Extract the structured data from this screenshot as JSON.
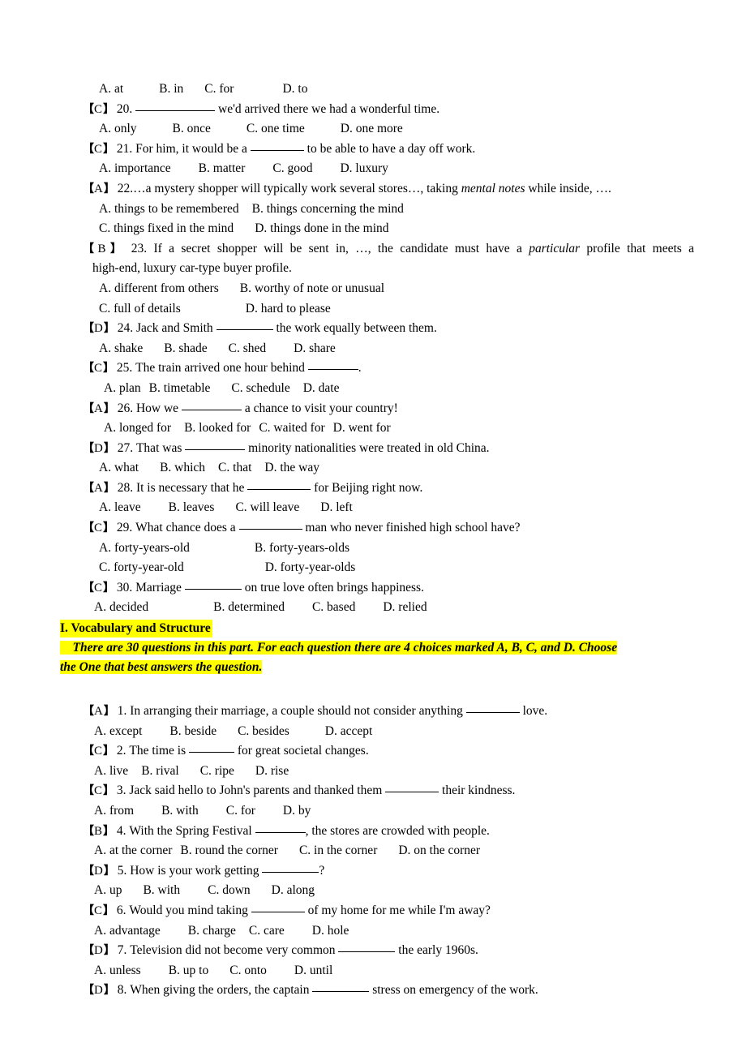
{
  "document": {
    "title": "Vocabulary and Structure Exam Paper",
    "highlight_color": "#ffff00",
    "text_color": "#000000",
    "background_color": "#ffffff"
  },
  "top_block": {
    "orphan_options": {
      "a": "A. at",
      "b": "B. in",
      "c": "C. for",
      "d": "D. to"
    },
    "questions": [
      {
        "answer": "C",
        "number": "20.",
        "text_after_blank": "we'd arrived there we had a wonderful time.",
        "options": {
          "a": "A. only",
          "b": "B. once",
          "c": "C. one time",
          "d": "D. one more"
        }
      },
      {
        "answer": "C",
        "number": "21.",
        "text_before_blank": "For him, it would be a",
        "text_after_blank": "to be able to have a day off work.",
        "options": {
          "a": "A. importance",
          "b": "B. matter",
          "c": "C. good",
          "d": "D. luxury"
        }
      },
      {
        "answer": "A",
        "number": "22.",
        "text_part1": "…a mystery shopper will typically work several stores…, taking ",
        "italic": "mental notes",
        "text_part2": " while inside, ….",
        "options": {
          "a": "A. things to be remembered",
          "b": "B. things concerning the mind",
          "c": "C. things fixed in the mind",
          "d": "D. things done in the mind"
        }
      },
      {
        "answer": "B",
        "number": "23.",
        "text_part1": "If a secret shopper will be sent in, …, the candidate must have a ",
        "italic": "particular",
        "text_part2": " profile that meets a",
        "text_continuation": "high-end, luxury car-type buyer profile.",
        "options": {
          "a": "A. different from others",
          "b": "B. worthy of note or unusual",
          "c": "C. full of details",
          "d": "D. hard to please"
        }
      },
      {
        "answer": "D",
        "number": "24.",
        "text_before_blank": "Jack and Smith",
        "text_after_blank": "the work equally between them.",
        "options": {
          "a": "A. shake",
          "b": "B. shade",
          "c": "C. shed",
          "d": "D. share"
        }
      },
      {
        "answer": "C",
        "number": "25.",
        "text_before_blank": "The train arrived one hour behind",
        "text_after_blank": ".",
        "options": {
          "a": "A. plan",
          "b": "B. timetable",
          "c": "C. schedule",
          "d": "D. date"
        }
      },
      {
        "answer": "A",
        "number": "26.",
        "text_before_blank": "How we",
        "text_after_blank": "a chance to visit your country!",
        "options": {
          "a": "A. longed for",
          "b": "B. looked for",
          "c": "C. waited for",
          "d": "D. went for"
        }
      },
      {
        "answer": "D",
        "number": "27.",
        "text_before_blank": "That was",
        "text_after_blank": "minority nationalities were treated in old China.",
        "options": {
          "a": "A. what",
          "b": "B. which",
          "c": "C. that",
          "d": "D. the way"
        }
      },
      {
        "answer": "A",
        "number": "28.",
        "text_before_blank": "It is necessary that he",
        "text_after_blank": "for Beijing right now.",
        "options": {
          "a": "A. leave",
          "b": "B. leaves",
          "c": "C. will leave",
          "d": "D. left"
        }
      },
      {
        "answer": "C",
        "number": "29.",
        "text_before_blank": "What chance does a",
        "text_after_blank": "man who never finished high school have?",
        "options": {
          "a": "A. forty-years-old",
          "b": "B. forty-years-olds",
          "c": "C. forty-year-old",
          "d": "D. forty-year-olds"
        }
      },
      {
        "answer": "C",
        "number": "30.",
        "text_before_blank": "Marriage",
        "text_after_blank": "on true love often brings happiness.",
        "options": {
          "a": "A. decided",
          "b": "B. determined",
          "c": "C. based",
          "d": "D. relied"
        }
      }
    ]
  },
  "section": {
    "heading": "I. Vocabulary and Structure",
    "instruction_line1": "There are 30 questions in this part. For each question there are 4 choices marked A, B, C, and D. Choose",
    "instruction_line2": "the One that best answers the question."
  },
  "bottom_block": {
    "questions": [
      {
        "answer": "A",
        "number": "1.",
        "text_before_blank": "In arranging their marriage, a couple should not consider anything",
        "text_after_blank": "love.",
        "options": {
          "a": "A. except",
          "b": "B. beside",
          "c": "C. besides",
          "d": "D. accept"
        }
      },
      {
        "answer": "C",
        "number": "2.",
        "text_before_blank": "The time is",
        "text_after_blank": "for great societal changes.",
        "options": {
          "a": "A. live",
          "b": "B. rival",
          "c": "C. ripe",
          "d": "D. rise"
        }
      },
      {
        "answer": "C",
        "number": "3.",
        "text_before_blank": "Jack said hello to John's parents and thanked them",
        "text_after_blank": "their kindness.",
        "options": {
          "a": "A. from",
          "b": "B. with",
          "c": "C. for",
          "d": "D. by"
        }
      },
      {
        "answer": "B",
        "number": "4.",
        "text_before_blank": "With the Spring Festival",
        "text_after_blank": ", the stores are crowded with people.",
        "options": {
          "a": "A. at the corner",
          "b": "B. round the corner",
          "c": "C. in the corner",
          "d": "D. on the corner"
        }
      },
      {
        "answer": "D",
        "number": "5.",
        "text_before_blank": "How is your work getting",
        "text_after_blank": "?",
        "options": {
          "a": "A. up",
          "b": "B. with",
          "c": "C. down",
          "d": "D. along"
        }
      },
      {
        "answer": "C",
        "number": "6.",
        "text_before_blank": "Would you mind taking",
        "text_after_blank": "of my home for me while I'm away?",
        "options": {
          "a": "A. advantage",
          "b": "B. charge",
          "c": "C. care",
          "d": "D. hole"
        }
      },
      {
        "answer": "D",
        "number": "7.",
        "text_before_blank": "Television did not become very common",
        "text_after_blank": "the early 1960s.",
        "options": {
          "a": "A. unless",
          "b": "B. up to",
          "c": "C. onto",
          "d": "D. until"
        }
      },
      {
        "answer": "D",
        "number": "8.",
        "text_before_blank": "When giving the orders, the captain",
        "text_after_blank": "stress on emergency of the work.",
        "options": null
      }
    ]
  }
}
